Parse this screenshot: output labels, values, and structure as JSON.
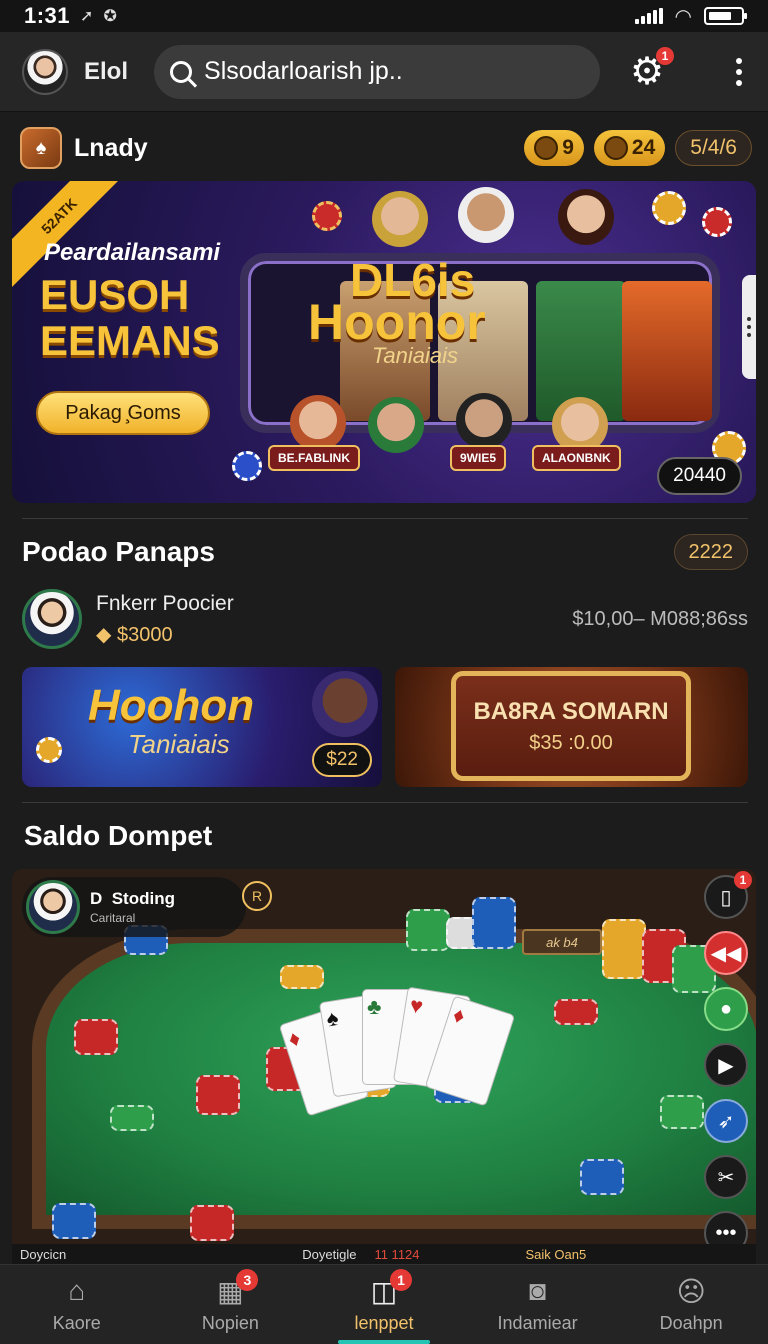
{
  "status_bar": {
    "time": "1:31"
  },
  "app_bar": {
    "title": "Elol",
    "search_value": "Slsodarloarish jp..",
    "settings_badge": "1"
  },
  "lobby": {
    "title": "Lnady",
    "chip_1": "9",
    "chip_2": "24",
    "chip_3": "5/4/6"
  },
  "hero": {
    "ribbon": "52ATK",
    "subtitle": "Peardailansami",
    "title_line1": "EUSOH",
    "title_line2": "EEMANS",
    "cta": "Pakag ̧Goms",
    "logo_line1": "DL6is",
    "logo_line2": "Hoonor",
    "logo_line3": "Taniaiais",
    "plate_1": "BE.FABLINK",
    "plate_2": "9WIE5",
    "plate_3": "ALAONBNK",
    "counter": "20440"
  },
  "popular": {
    "title": "Podao Panaps",
    "count": "2222",
    "player_name": "Fnkerr Poocier",
    "player_amount": "$3000",
    "stake_range": "$10,00– M088;86ss",
    "card1_title": "Hoohon",
    "card1_sub": "Taniaiais",
    "card1_count": "$22",
    "card2_title": "BA8RA SOMARN",
    "card2_value": "$35 :0.00"
  },
  "wallet": {
    "title": "Saldo Dompet",
    "dealer_name": "D  Stoding",
    "dealer_sub": "Caritaral",
    "table_sign": "ak b4",
    "side_badge": "1"
  },
  "ticker": {
    "item_1": "Doycicn",
    "item_2": "Doyetigle",
    "item_3": "11 1124",
    "item_4": "Saik Oan5"
  },
  "bottom_nav": {
    "items": [
      {
        "label": "Kaore",
        "badge": ""
      },
      {
        "label": "Nopien",
        "badge": "3"
      },
      {
        "label": "lenppet",
        "badge": "1"
      },
      {
        "label": "Indamiear",
        "badge": ""
      },
      {
        "label": "Doahpn",
        "badge": ""
      }
    ]
  },
  "colors": {
    "background": "#1c1c1c",
    "accent_gold": "#f2c26b",
    "active_underline": "#23c4b4",
    "badge_red": "#e53935",
    "felt_green": "#1f7f41"
  },
  "icons": [
    "navigation-arrow-icon",
    "notification-icon",
    "signal-icon",
    "wifi-icon",
    "battery-icon",
    "search-icon",
    "gear-icon",
    "more-vert-icon",
    "home-icon",
    "shop-icon",
    "wallet-icon",
    "camera-icon",
    "support-icon"
  ]
}
